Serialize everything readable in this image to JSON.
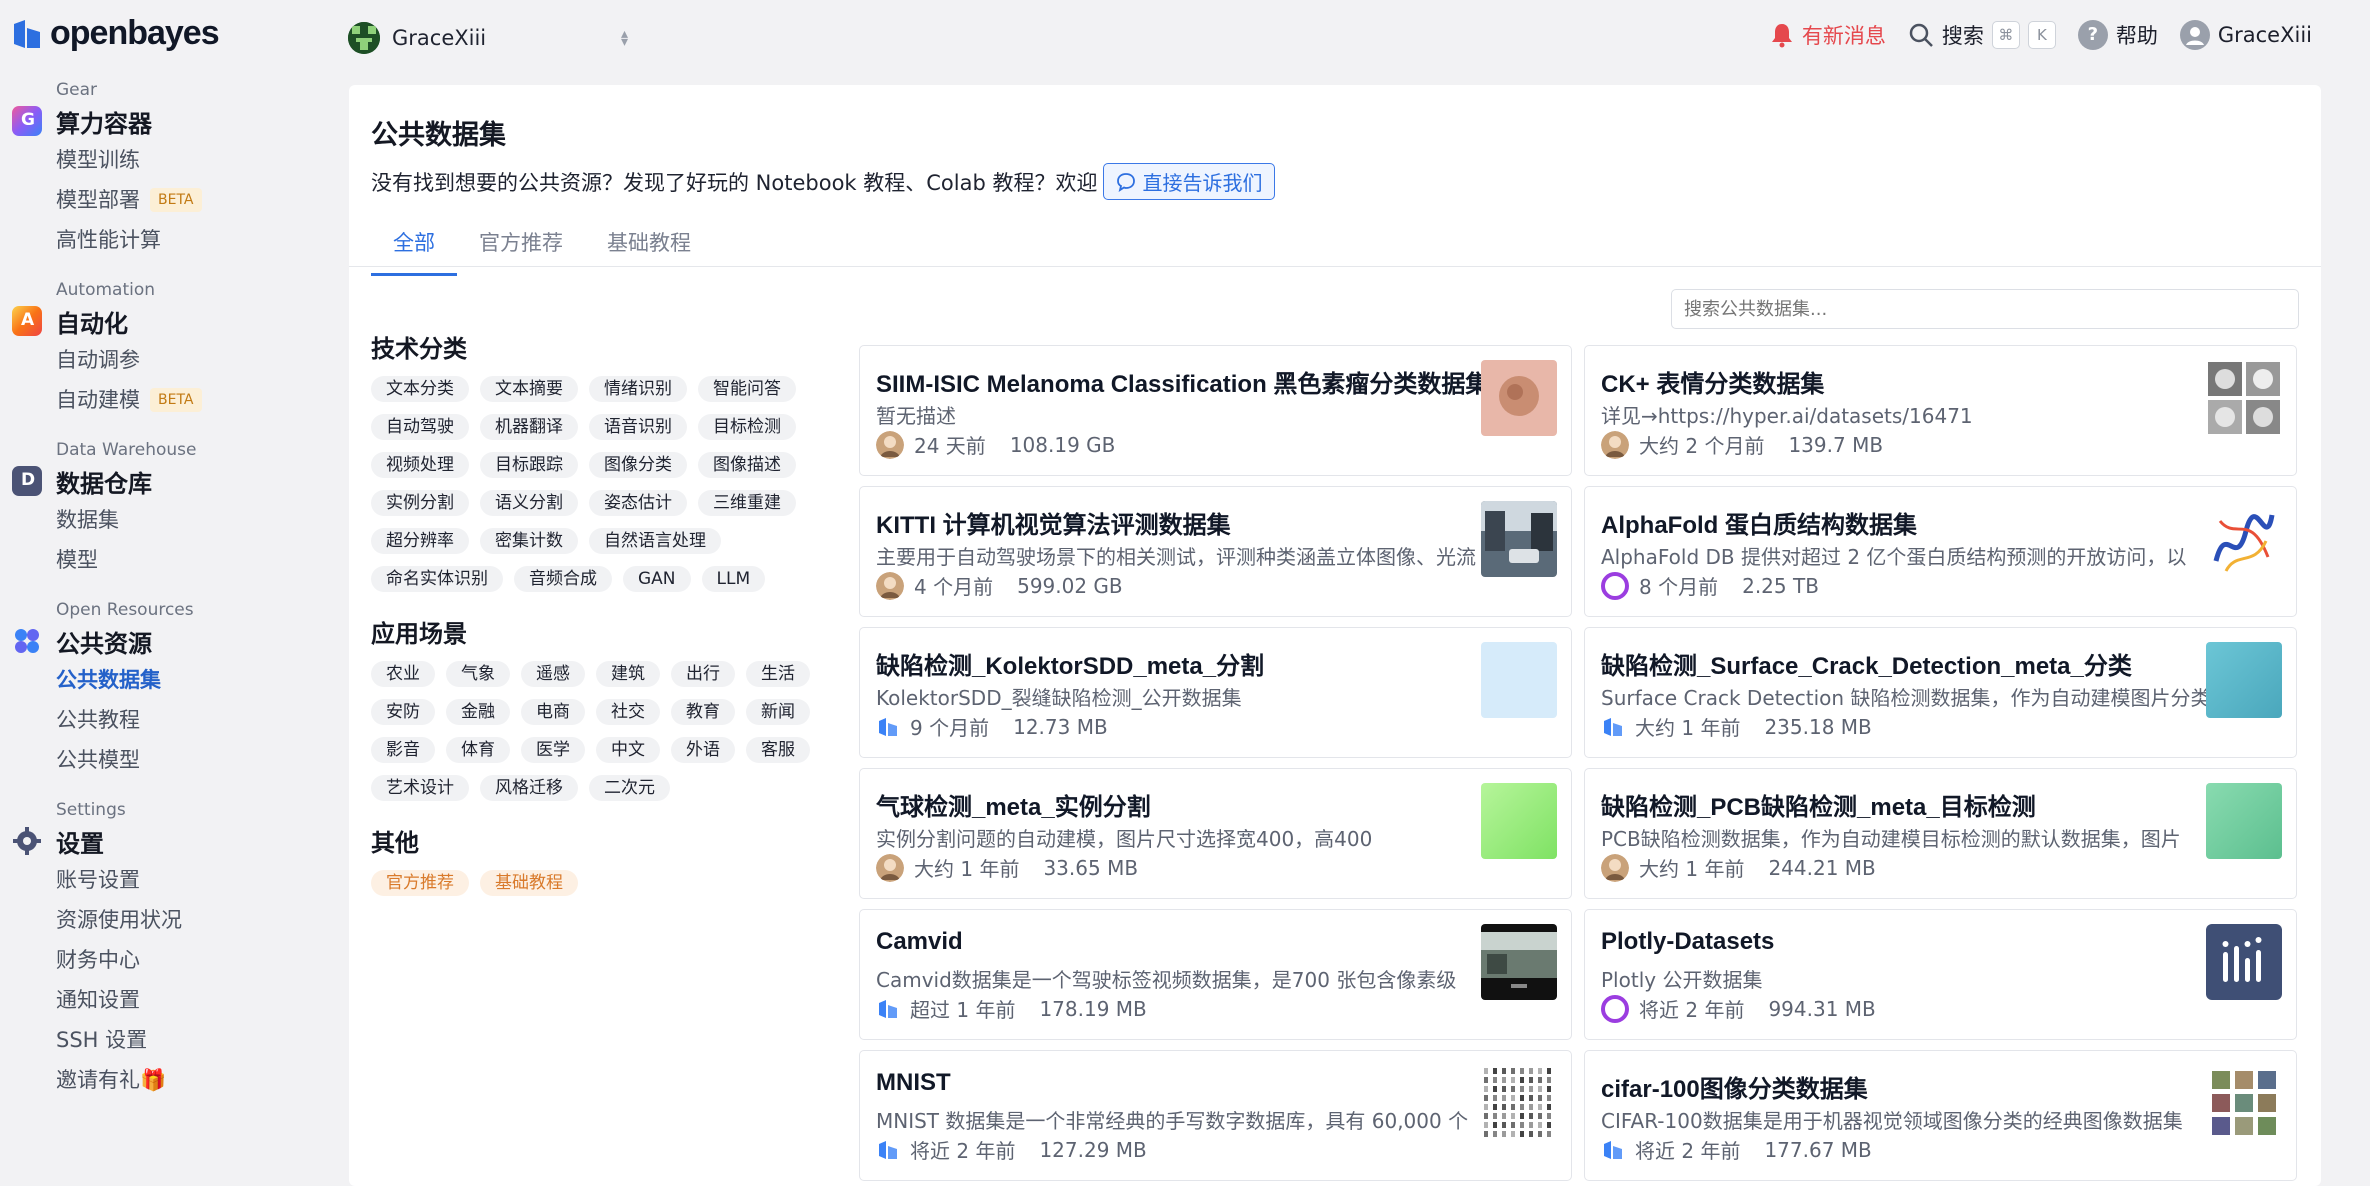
{
  "brand": {
    "name": "openbayes"
  },
  "workspace": {
    "name": "GraceXiii"
  },
  "topbar": {
    "notice": "有新消息",
    "search_label": "搜索",
    "kbd_cmd": "⌘",
    "kbd_k": "K",
    "help": "帮助",
    "user": "GraceXiii"
  },
  "sidebar": {
    "sections": [
      {
        "en": "Gear",
        "title": "算力容器",
        "items": [
          {
            "label": "模型训练",
            "badge": ""
          },
          {
            "label": "模型部署",
            "badge": "BETA"
          },
          {
            "label": "高性能计算",
            "badge": ""
          }
        ]
      },
      {
        "en": "Automation",
        "title": "自动化",
        "items": [
          {
            "label": "自动调参",
            "badge": ""
          },
          {
            "label": "自动建模",
            "badge": "BETA"
          }
        ]
      },
      {
        "en": "Data Warehouse",
        "title": "数据仓库",
        "items": [
          {
            "label": "数据集",
            "badge": ""
          },
          {
            "label": "模型",
            "badge": ""
          }
        ]
      },
      {
        "en": "Open Resources",
        "title": "公共资源",
        "items": [
          {
            "label": "公共数据集",
            "badge": "",
            "active": true
          },
          {
            "label": "公共教程",
            "badge": ""
          },
          {
            "label": "公共模型",
            "badge": ""
          }
        ]
      },
      {
        "en": "Settings",
        "title": "设置",
        "items": [
          {
            "label": "账号设置",
            "badge": ""
          },
          {
            "label": "资源使用状况",
            "badge": ""
          },
          {
            "label": "财务中心",
            "badge": ""
          },
          {
            "label": "通知设置",
            "badge": ""
          },
          {
            "label": "SSH 设置",
            "badge": ""
          },
          {
            "label": "邀请有礼🎁",
            "badge": ""
          }
        ]
      }
    ]
  },
  "page": {
    "title": "公共数据集",
    "intro": "没有找到想要的公共资源？发现了好玩的 Notebook 教程、Colab 教程？欢迎",
    "tell_button": "直接告诉我们",
    "tabs": [
      "全部",
      "官方推荐",
      "基础教程"
    ],
    "search_placeholder": "搜索公共数据集..."
  },
  "filters": [
    {
      "title": "技术分类",
      "chips": [
        "文本分类",
        "文本摘要",
        "情绪识别",
        "智能问答",
        "自动驾驶",
        "机器翻译",
        "语音识别",
        "目标检测",
        "视频处理",
        "目标跟踪",
        "图像分类",
        "图像描述",
        "实例分割",
        "语义分割",
        "姿态估计",
        "三维重建",
        "超分辨率",
        "密集计数",
        "自然语言处理",
        "命名实体识别",
        "音频合成",
        "GAN",
        "LLM"
      ]
    },
    {
      "title": "应用场景",
      "chips": [
        "农业",
        "气象",
        "遥感",
        "建筑",
        "出行",
        "生活",
        "安防",
        "金融",
        "电商",
        "社交",
        "教育",
        "新闻",
        "影音",
        "体育",
        "医学",
        "中文",
        "外语",
        "客服",
        "艺术设计",
        "风格迁移",
        "二次元"
      ]
    },
    {
      "title": "其他",
      "chips": [
        "官方推荐",
        "基础教程"
      ],
      "style": "orange"
    }
  ],
  "datasets": [
    {
      "title": "SIIM-ISIC Melanoma Classification 黑色素瘤分类数据集",
      "desc": "暂无描述",
      "time": "24 天前",
      "size": "108.19 GB",
      "avatar": "user-avatar-icon",
      "thumb": "skin-lesion-thumbnail"
    },
    {
      "title": "CK+ 表情分类数据集",
      "desc": "详见→https://hyper.ai/datasets/16471",
      "time": "大约 2 个月前",
      "size": "139.7 MB",
      "avatar": "user-avatar-icon",
      "thumb": "faces-thumbnail"
    },
    {
      "title": "KITTI 计算机视觉算法评测数据集",
      "desc": "主要用于自动驾驶场景下的相关测试，评测种类涵盖立体图像、光流",
      "time": "4 个月前",
      "size": "599.02 GB",
      "avatar": "user-avatar-icon",
      "thumb": "street-thumbnail"
    },
    {
      "title": "AlphaFold 蛋白质结构数据集",
      "desc": "AlphaFold DB 提供对超过 2 亿个蛋白质结构预测的开放访问，以",
      "time": "8 个月前",
      "size": "2.25 TB",
      "avatar": "ring-avatar-icon",
      "thumb": "protein-thumbnail"
    },
    {
      "title": "缺陷检测_KolektorSDD_meta_分割",
      "desc": "KolektorSDD_裂缝缺陷检测_公开数据集",
      "time": "9 个月前",
      "size": "12.73 MB",
      "avatar": "cube-icon",
      "thumb": "light-blue-thumbnail"
    },
    {
      "title": "缺陷检测_Surface_Crack_Detection_meta_分类",
      "desc": "Surface Crack Detection 缺陷检测数据集，作为自动建模图片分类",
      "time": "大约 1 年前",
      "size": "235.18 MB",
      "avatar": "cube-icon",
      "thumb": "teal-thumbnail"
    },
    {
      "title": "气球检测_meta_实例分割",
      "desc": "实例分割问题的自动建模，图片尺寸选择宽400，高400",
      "time": "大约 1 年前",
      "size": "33.65 MB",
      "avatar": "user-avatar-icon",
      "thumb": "green-thumbnail"
    },
    {
      "title": "缺陷检测_PCB缺陷检测_meta_目标检测",
      "desc": "PCB缺陷检测数据集，作为自动建模目标检测的默认数据集，图片",
      "time": "大约 1 年前",
      "size": "244.21 MB",
      "avatar": "user-avatar-icon",
      "thumb": "mint-thumbnail"
    },
    {
      "title": "Camvid",
      "desc": "Camvid数据集是一个驾驶标签视频数据集，是700 张包含像素级",
      "time": "超过 1 年前",
      "size": "178.19 MB",
      "avatar": "cube-icon",
      "thumb": "camvid-thumbnail"
    },
    {
      "title": "Plotly-Datasets",
      "desc": "Plotly 公开数据集",
      "time": "将近 2 年前",
      "size": "994.31 MB",
      "avatar": "ring-avatar-icon",
      "thumb": "plotly-logo-thumbnail"
    },
    {
      "title": "MNIST",
      "desc": "MNIST 数据集是一个非常经典的手写数字数据库，具有 60,000 个",
      "time": "将近 2 年前",
      "size": "127.29 MB",
      "avatar": "cube-icon",
      "thumb": "mnist-digits-thumbnail"
    },
    {
      "title": "cifar-100图像分类数据集",
      "desc": "CIFAR-100数据集是用于机器视觉领域图像分类的经典图像数据集",
      "time": "将近 2 年前",
      "size": "177.67 MB",
      "avatar": "cube-icon",
      "thumb": "cifar-grid-thumbnail"
    }
  ],
  "colors": {
    "accent": "#2d6fe0",
    "notice": "#e5484d",
    "beta_bg": "#fcefd6",
    "beta_fg": "#c27a13"
  }
}
